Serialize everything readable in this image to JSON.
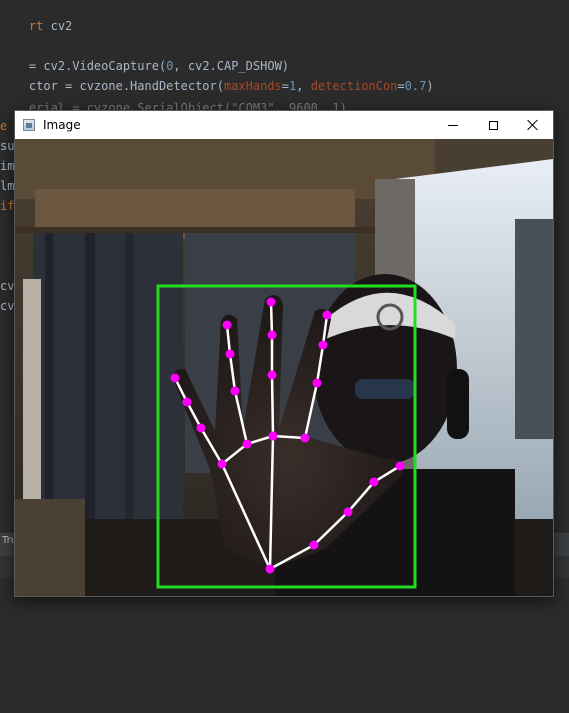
{
  "editor": {
    "lines": [
      {
        "a": "rt ",
        "b": "cv2"
      },
      {
        "a": "= cv2.VideoCapture(",
        "n1": "0",
        "b": ", cv2.CAP_DSHOW)"
      },
      {
        "a": "ctor = cvzone.HandDetector(",
        "p1": "maxHands",
        "c": "=",
        "n1": "1",
        "d": ", ",
        "p2": "detectionCon",
        "e": "=",
        "n2": "0.7",
        "f": ")"
      },
      {
        "faded": "erial = cvzone.SerialObject(\"COM3\", 9600, 1)"
      }
    ],
    "fragments": [
      "e",
      "su",
      "im",
      "lm",
      "if",
      "cv",
      "cv"
    ],
    "run_label": "Tru"
  },
  "window": {
    "title": "Image",
    "controls": {
      "minimize": "minimize",
      "maximize": "maximize",
      "close": "close"
    }
  },
  "colors": {
    "editor_bg": "#2b2b2b",
    "bounding_box": "#22dd22",
    "landmark": "#ff00ff",
    "connection": "#ffffff"
  }
}
